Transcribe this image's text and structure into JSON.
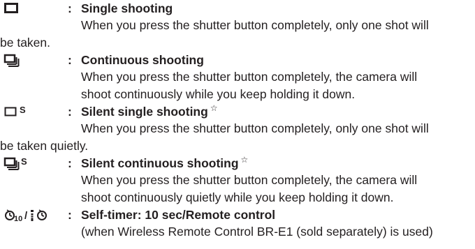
{
  "entries": [
    {
      "icon": "single-shooting-icon",
      "colon": ":",
      "title": "Single shooting",
      "star": "",
      "desc_line1": "When you press the shutter button completely, only one shot will",
      "desc_line2": "be taken."
    },
    {
      "icon": "continuous-shooting-icon",
      "colon": ":",
      "title": "Continuous shooting",
      "star": "",
      "desc_line1": "When you press the shutter button completely, the camera will",
      "desc_line2": "shoot continuously while you keep holding it down."
    },
    {
      "icon": "silent-single-shooting-icon",
      "colon": ":",
      "title": "Silent single shooting",
      "star": "☆",
      "desc_line1": "When you press the shutter button completely, only one shot will",
      "desc_line2": "be taken quietly."
    },
    {
      "icon": "silent-continuous-shooting-icon",
      "colon": ":",
      "title": "Silent continuous shooting",
      "star": "☆",
      "desc_line1": "When you press the shutter button completely, the camera will",
      "desc_line2": "shoot continuously quietly while you keep holding it down."
    },
    {
      "icon": "self-timer-remote-icon",
      "colon": ":",
      "title": "Self-timer: 10 sec/Remote control",
      "star": "",
      "desc_line1": "(when Wireless Remote Control BR-E1 (sold separately) is used)",
      "desc_line2": ""
    }
  ],
  "icon_text": {
    "silent_suffix": "S",
    "timer_value": "10",
    "separator": "/"
  }
}
